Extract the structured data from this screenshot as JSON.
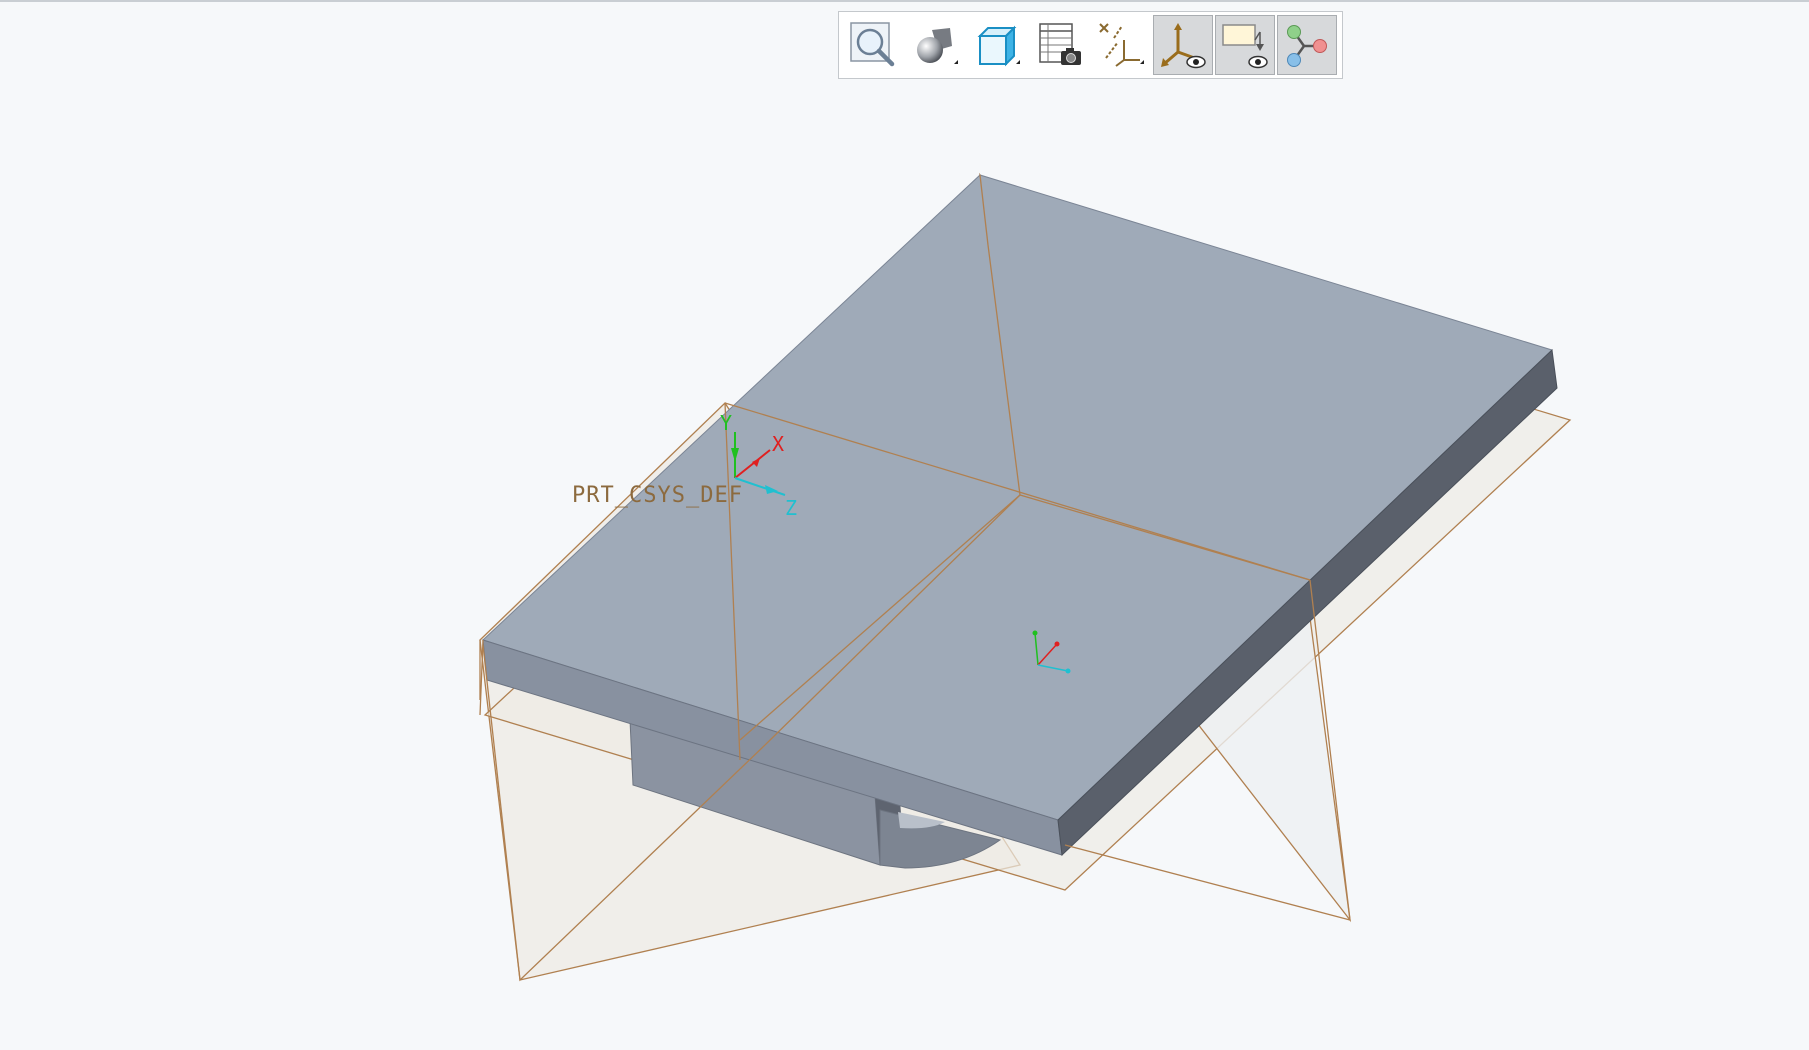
{
  "toolbar": {
    "buttons": [
      {
        "name": "zoom",
        "icon": "magnifier-icon"
      },
      {
        "name": "display-style",
        "icon": "shaded-sphere-icon"
      },
      {
        "name": "saved-orientations",
        "icon": "cube-view-icon"
      },
      {
        "name": "view-manager",
        "icon": "table-camera-icon"
      },
      {
        "name": "datum-display-filters",
        "icon": "datum-axes-icon"
      },
      {
        "name": "csys-display",
        "icon": "csys-eye-icon"
      },
      {
        "name": "annotation-display",
        "icon": "annotation-eye-icon"
      },
      {
        "name": "spin-center",
        "icon": "spin-center-icon"
      }
    ]
  },
  "model": {
    "csys_name": "PRT_CSYS_DEF",
    "axis_x": "X",
    "axis_y": "Y",
    "axis_z": "Z"
  },
  "colors": {
    "background": "#f6f8fa",
    "top_face": "#9faab8",
    "front_face": "#8891a0",
    "side_face": "#5a606b",
    "datum_plane_edge": "#b08050",
    "x_axis": "#e02020",
    "y_axis": "#20c020",
    "z_axis": "#20c0d0"
  }
}
